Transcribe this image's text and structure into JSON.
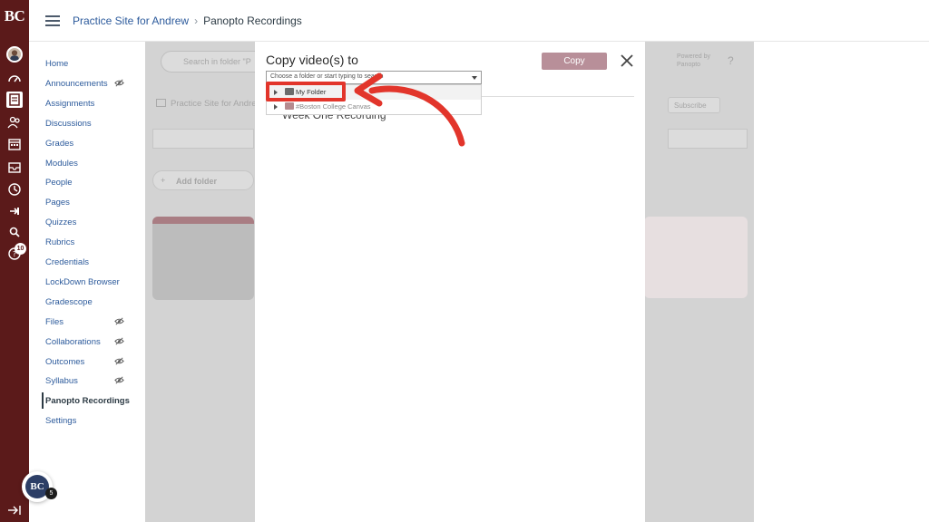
{
  "global_nav": {
    "logo": "BC",
    "history_badge": "10",
    "icons": [
      "account-icon",
      "dashboard-icon",
      "courses-icon",
      "groups-icon",
      "calendar-icon",
      "inbox-icon",
      "history-icon",
      "external-tool-icon",
      "search-tool-icon",
      "help-icon",
      "collapse-nav-icon"
    ]
  },
  "breadcrumb": {
    "course": "Practice Site for Andrew",
    "page": "Panopto Recordings"
  },
  "course_nav": {
    "items": [
      {
        "label": "Home",
        "hidden": false
      },
      {
        "label": "Announcements",
        "hidden": true
      },
      {
        "label": "Assignments",
        "hidden": false
      },
      {
        "label": "Discussions",
        "hidden": false
      },
      {
        "label": "Grades",
        "hidden": false
      },
      {
        "label": "Modules",
        "hidden": false
      },
      {
        "label": "People",
        "hidden": false
      },
      {
        "label": "Pages",
        "hidden": false
      },
      {
        "label": "Quizzes",
        "hidden": false
      },
      {
        "label": "Rubrics",
        "hidden": false
      },
      {
        "label": "Credentials",
        "hidden": false
      },
      {
        "label": "LockDown Browser",
        "hidden": false
      },
      {
        "label": "Gradescope",
        "hidden": false
      },
      {
        "label": "Files",
        "hidden": true
      },
      {
        "label": "Collaborations",
        "hidden": true
      },
      {
        "label": "Outcomes",
        "hidden": true
      },
      {
        "label": "Syllabus",
        "hidden": true
      },
      {
        "label": "Panopto Recordings",
        "hidden": false,
        "active": true
      },
      {
        "label": "Settings",
        "hidden": false
      }
    ]
  },
  "dock": {
    "avatar_text": "BC",
    "count": "5"
  },
  "panopto": {
    "search_placeholder": "Search in folder \"P",
    "folder_path": "Practice Site for Andre",
    "add_folder": "Add folder",
    "powered_by": "Powered by\nPanopto",
    "help": "?",
    "subscribe": "Subscribe"
  },
  "modal": {
    "title": "Copy video(s) to",
    "copy_button": "Copy",
    "select_placeholder": "Choose a folder or start typing to search",
    "folders": [
      {
        "label": "My Folder"
      },
      {
        "label": "#Boston College Canvas"
      }
    ],
    "background_session": "Week One Recording"
  },
  "annotation": {
    "highlight_color": "#e2352b"
  }
}
